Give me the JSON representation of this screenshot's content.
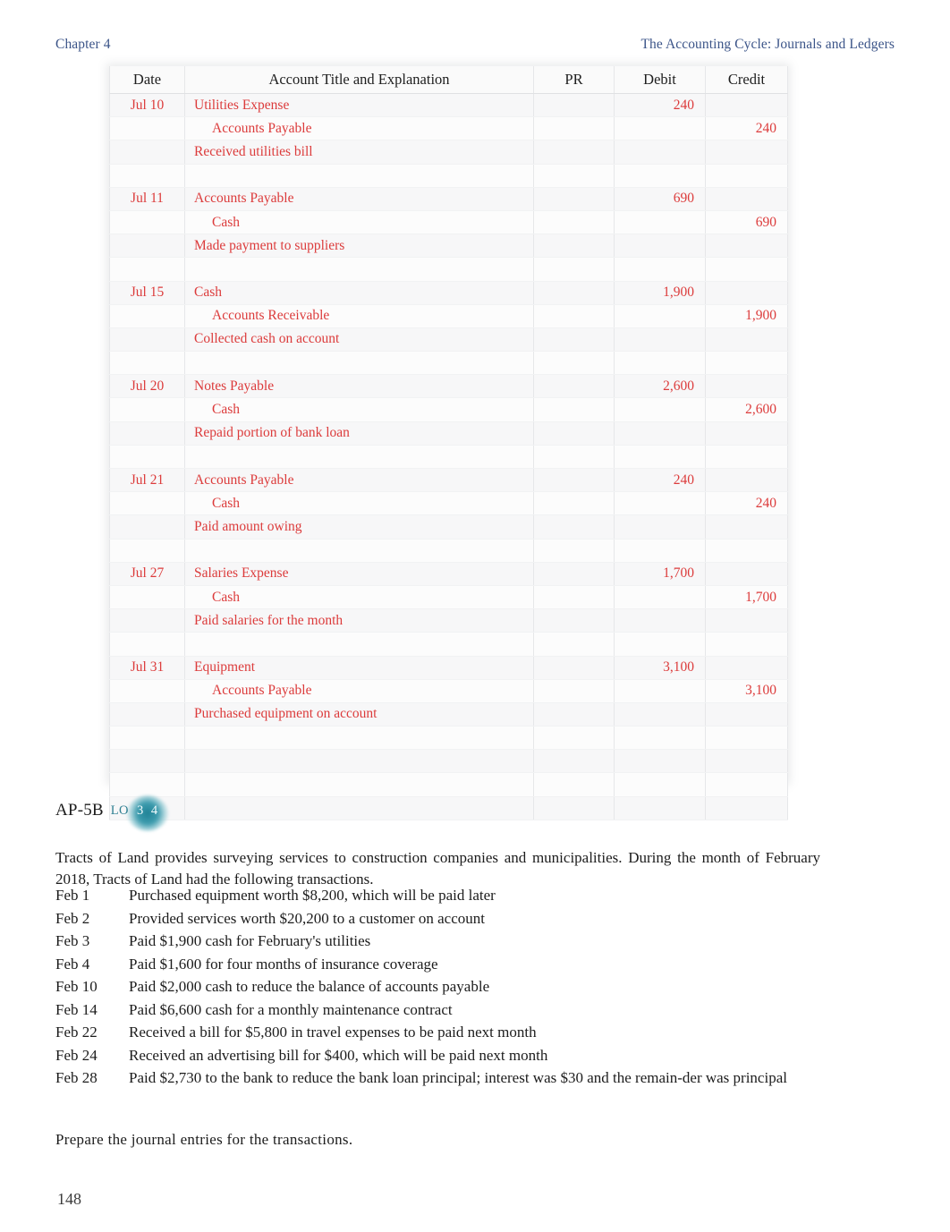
{
  "running_head": {
    "chapter": "Chapter 4",
    "title": "The Accounting Cycle: Journals and Ledgers"
  },
  "journal": {
    "columns": [
      "Date",
      "Account Title and Explanation",
      "PR",
      "Debit",
      "Credit"
    ],
    "rows": [
      {
        "date": "Jul 10",
        "account": "Utilities Expense",
        "indent": 1,
        "pr": "",
        "debit": "240",
        "credit": ""
      },
      {
        "date": "",
        "account": "Accounts Payable",
        "indent": 2,
        "pr": "",
        "debit": "",
        "credit": "240"
      },
      {
        "date": "",
        "account": "Received utilities bill",
        "indent": 1,
        "pr": "",
        "debit": "",
        "credit": ""
      },
      {
        "date": "",
        "account": "",
        "indent": 1,
        "pr": "",
        "debit": "",
        "credit": ""
      },
      {
        "date": "Jul 11",
        "account": "Accounts Payable",
        "indent": 1,
        "pr": "",
        "debit": "690",
        "credit": ""
      },
      {
        "date": "",
        "account": "Cash",
        "indent": 2,
        "pr": "",
        "debit": "",
        "credit": "690"
      },
      {
        "date": "",
        "account": "Made payment to suppliers",
        "indent": 1,
        "pr": "",
        "debit": "",
        "credit": ""
      },
      {
        "date": "",
        "account": "",
        "indent": 1,
        "pr": "",
        "debit": "",
        "credit": ""
      },
      {
        "date": "Jul 15",
        "account": "Cash",
        "indent": 1,
        "pr": "",
        "debit": "1,900",
        "credit": ""
      },
      {
        "date": "",
        "account": "Accounts Receivable",
        "indent": 2,
        "pr": "",
        "debit": "",
        "credit": "1,900"
      },
      {
        "date": "",
        "account": "Collected cash on account",
        "indent": 1,
        "pr": "",
        "debit": "",
        "credit": ""
      },
      {
        "date": "",
        "account": "",
        "indent": 1,
        "pr": "",
        "debit": "",
        "credit": ""
      },
      {
        "date": "Jul 20",
        "account": "Notes Payable",
        "indent": 1,
        "pr": "",
        "debit": "2,600",
        "credit": ""
      },
      {
        "date": "",
        "account": "Cash",
        "indent": 2,
        "pr": "",
        "debit": "",
        "credit": "2,600"
      },
      {
        "date": "",
        "account": "Repaid portion of bank loan",
        "indent": 1,
        "pr": "",
        "debit": "",
        "credit": ""
      },
      {
        "date": "",
        "account": "",
        "indent": 1,
        "pr": "",
        "debit": "",
        "credit": ""
      },
      {
        "date": "Jul 21",
        "account": "Accounts Payable",
        "indent": 1,
        "pr": "",
        "debit": "240",
        "credit": ""
      },
      {
        "date": "",
        "account": "Cash",
        "indent": 2,
        "pr": "",
        "debit": "",
        "credit": "240"
      },
      {
        "date": "",
        "account": "Paid amount owing",
        "indent": 1,
        "pr": "",
        "debit": "",
        "credit": ""
      },
      {
        "date": "",
        "account": "",
        "indent": 1,
        "pr": "",
        "debit": "",
        "credit": ""
      },
      {
        "date": "Jul 27",
        "account": "Salaries Expense",
        "indent": 1,
        "pr": "",
        "debit": "1,700",
        "credit": ""
      },
      {
        "date": "",
        "account": "Cash",
        "indent": 2,
        "pr": "",
        "debit": "",
        "credit": "1,700"
      },
      {
        "date": "",
        "account": "Paid salaries for the month",
        "indent": 1,
        "pr": "",
        "debit": "",
        "credit": ""
      },
      {
        "date": "",
        "account": "",
        "indent": 1,
        "pr": "",
        "debit": "",
        "credit": ""
      },
      {
        "date": "Jul 31",
        "account": "Equipment",
        "indent": 1,
        "pr": "",
        "debit": "3,100",
        "credit": ""
      },
      {
        "date": "",
        "account": "Accounts Payable",
        "indent": 2,
        "pr": "",
        "debit": "",
        "credit": "3,100"
      },
      {
        "date": "",
        "account": "Purchased equipment on account",
        "indent": 1,
        "pr": "",
        "debit": "",
        "credit": ""
      },
      {
        "date": "",
        "account": "",
        "indent": 1,
        "pr": "",
        "debit": "",
        "credit": ""
      },
      {
        "date": "",
        "account": "",
        "indent": 1,
        "pr": "",
        "debit": "",
        "credit": ""
      },
      {
        "date": "",
        "account": "",
        "indent": 1,
        "pr": "",
        "debit": "",
        "credit": ""
      },
      {
        "date": "",
        "account": "",
        "indent": 1,
        "pr": "",
        "debit": "",
        "credit": ""
      }
    ]
  },
  "problem": {
    "code": "AP-5B",
    "lo_label": "LO",
    "lo_numbers": "3 4",
    "lo_color": "#2e7f92",
    "intro": "Tracts of Land provides surveying services to construction companies and municipalities. During the month of February 2018, Tracts of Land had the following transactions.",
    "transactions": [
      {
        "date": "Feb 1",
        "description": "Purchased equipment worth $8,200, which will be paid later"
      },
      {
        "date": "Feb 2",
        "description": "Provided services worth $20,200 to a customer on account"
      },
      {
        "date": "Feb 3",
        "description": "Paid $1,900 cash for February's utilities"
      },
      {
        "date": "Feb 4",
        "description": "Paid $1,600 for four months of insurance coverage"
      },
      {
        "date": "Feb 10",
        "description": "Paid $2,000 cash to reduce the balance of accounts payable"
      },
      {
        "date": "Feb 14",
        "description": "Paid $6,600 cash for a monthly maintenance contract"
      },
      {
        "date": "Feb 22",
        "description": "Received a bill for $5,800 in travel expenses to be paid next month"
      },
      {
        "date": "Feb 24",
        "description": "Received an advertising bill for $400, which will be paid next month"
      },
      {
        "date": "Feb 28",
        "description": "Paid $2,730 to the bank to reduce the bank loan principal; interest was $30 and the remain-der was principal"
      }
    ],
    "prepare_note": "Prepare the journal entries for the transactions."
  },
  "page_number": "148",
  "colors": {
    "entry_red": "#dc3b3b",
    "header_blue": "#3b5488",
    "lo_teal": "#1f8296"
  }
}
